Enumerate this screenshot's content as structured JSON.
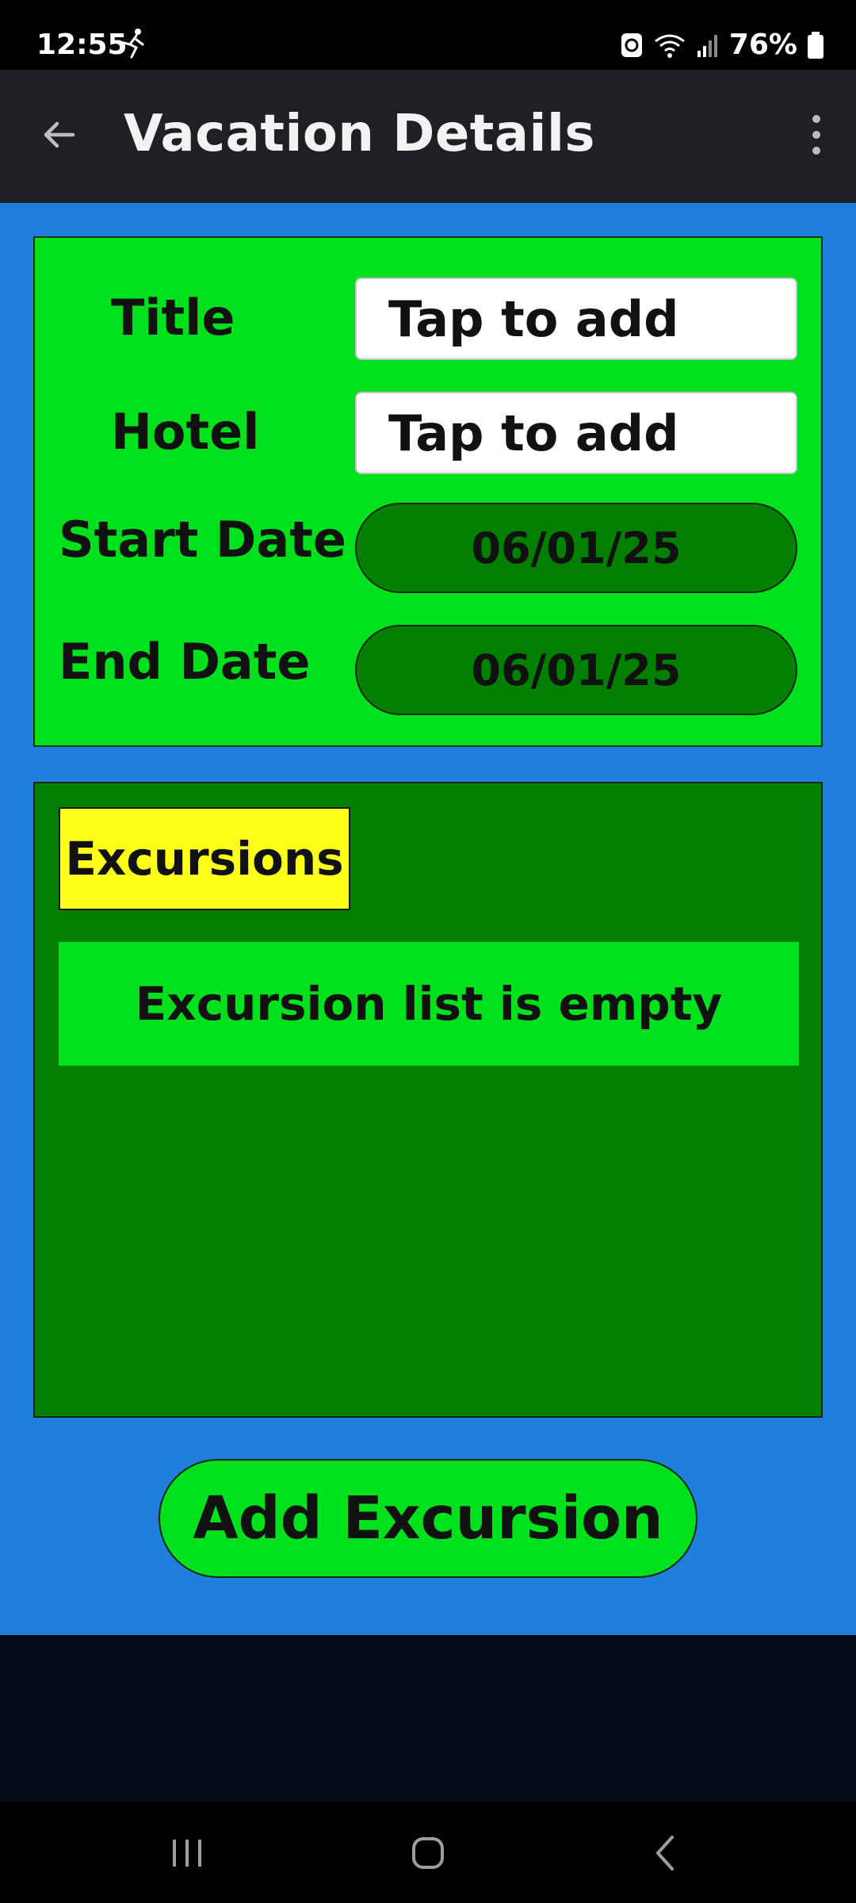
{
  "status_bar": {
    "time": "12:55",
    "battery_text": "76%",
    "icons": [
      "activity-icon",
      "auto-sync-icon",
      "wifi-icon",
      "signal-icon",
      "battery-icon"
    ]
  },
  "app_bar": {
    "title": "Vacation Details",
    "icons": [
      "back-arrow-icon",
      "more-vert-icon"
    ]
  },
  "details": {
    "title_label": "Title",
    "title_placeholder": "Tap to add",
    "hotel_label": "Hotel",
    "hotel_placeholder": "Tap to add",
    "start_date_label": "Start Date",
    "start_date_value": "06/01/25",
    "end_date_label": "End Date",
    "end_date_value": "06/01/25"
  },
  "excursions": {
    "heading": "Excursions",
    "empty_message": "Excursion list is empty"
  },
  "actions": {
    "add_excursion_label": "Add Excursion"
  },
  "nav_bar": {
    "icons": [
      "recent-apps-icon",
      "home-icon",
      "back-icon"
    ]
  },
  "colors": {
    "content_background": "#1e7fdb",
    "card_bright_green": "#00e01d",
    "card_dark_green": "#007f00",
    "heading_yellow": "#ffff1a",
    "app_bar": "#1f1f26"
  }
}
